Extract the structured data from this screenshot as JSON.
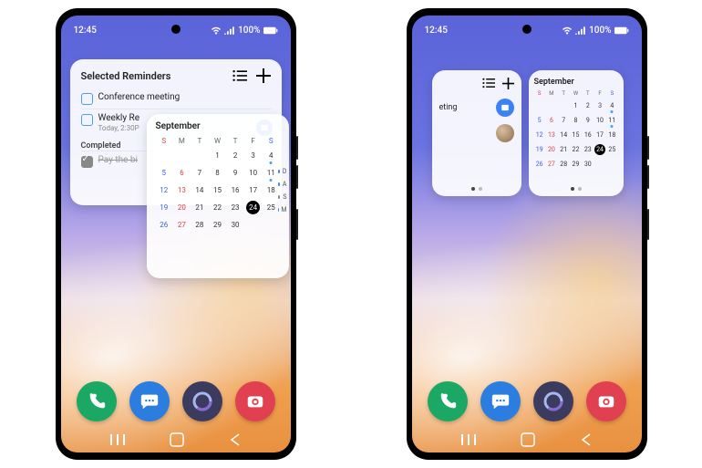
{
  "statusbar": {
    "time": "12:45",
    "battery": "100%"
  },
  "reminders": {
    "title": "Selected Reminders",
    "items": [
      {
        "label": "Conference meeting",
        "sub": ""
      },
      {
        "label": "Weekly Re",
        "sub": "Today, 2:30P"
      }
    ],
    "completed_label": "Completed",
    "completed_items": [
      {
        "label": "Pay the bi"
      }
    ]
  },
  "reminders_small": {
    "row0": "eting"
  },
  "calendar": {
    "month": "September",
    "dow": [
      "S",
      "M",
      "T",
      "W",
      "T",
      "F",
      "S"
    ],
    "today": 24,
    "first_day_col": 3,
    "days_in_month": 30,
    "sundays": [
      6,
      13,
      20,
      27
    ],
    "saturdays": [
      5,
      12,
      19,
      26
    ],
    "dots": [
      4,
      11
    ]
  },
  "calendar_side_events": [
    {
      "color": "#3b82f6",
      "label": "D"
    },
    {
      "color": "#3b82f6",
      "label": "A"
    },
    {
      "color": "#888",
      "label": "S"
    },
    {
      "color": "#3b82f6",
      "label": "M"
    }
  ],
  "dock": [
    "phone",
    "messages",
    "browser",
    "camera"
  ],
  "nav": [
    "recents",
    "home",
    "back"
  ]
}
